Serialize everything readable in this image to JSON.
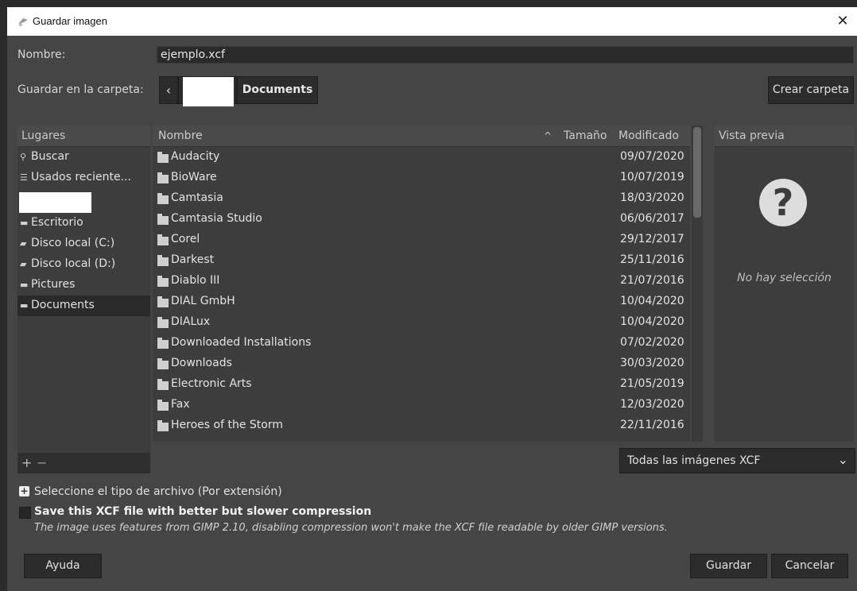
{
  "window": {
    "title": "Guardar imagen",
    "close_glyph": "✕"
  },
  "name": {
    "label": "Nombre:",
    "value": "ejemplo.xcf"
  },
  "folder": {
    "label": "Guardar en la carpeta:",
    "back_glyph": "‹",
    "current": "Documents",
    "create_label": "Crear carpeta"
  },
  "places": {
    "header": "Lugares",
    "items": [
      {
        "label": "Buscar",
        "icon": "search-icon",
        "glyph": "🔍"
      },
      {
        "label": "Usados reciente...",
        "icon": "recent-icon",
        "glyph": "☰"
      },
      {
        "label": "Escritorio",
        "icon": "folder-icon",
        "glyph": "▬"
      },
      {
        "label": "Disco local (C:)",
        "icon": "drive-icon",
        "glyph": "▰"
      },
      {
        "label": "Disco local (D:)",
        "icon": "drive-icon",
        "glyph": "▰"
      },
      {
        "label": "Pictures",
        "icon": "folder-icon",
        "glyph": "▬"
      },
      {
        "label": "Documents",
        "icon": "folder-icon",
        "glyph": "▬"
      }
    ],
    "add_glyph": "+",
    "remove_glyph": "−"
  },
  "files": {
    "headers": {
      "name": "Nombre",
      "sort_glyph": "^",
      "size": "Tamaño",
      "modified": "Modificado"
    },
    "rows": [
      {
        "name": "Audacity",
        "modified": "09/07/2020"
      },
      {
        "name": "BioWare",
        "modified": "10/07/2019"
      },
      {
        "name": "Camtasia",
        "modified": "18/03/2020"
      },
      {
        "name": "Camtasia Studio",
        "modified": "06/06/2017"
      },
      {
        "name": "Corel",
        "modified": "29/12/2017"
      },
      {
        "name": "Darkest",
        "modified": "25/11/2016"
      },
      {
        "name": "Diablo III",
        "modified": "21/07/2016"
      },
      {
        "name": "DIAL GmbH",
        "modified": "10/04/2020"
      },
      {
        "name": "DIALux",
        "modified": "10/04/2020"
      },
      {
        "name": "Downloaded Installations",
        "modified": "07/02/2020"
      },
      {
        "name": "Downloads",
        "modified": "30/03/2020"
      },
      {
        "name": "Electronic Arts",
        "modified": "21/05/2019"
      },
      {
        "name": "Fax",
        "modified": "12/03/2020"
      },
      {
        "name": "Heroes of the Storm",
        "modified": "22/11/2016"
      }
    ]
  },
  "preview": {
    "header": "Vista previa",
    "icon_glyph": "?",
    "empty_text": "No hay selección"
  },
  "filter": {
    "selected": "Todas las imágenes XCF",
    "chevron_glyph": "⌄"
  },
  "options": {
    "expander_glyph": "+",
    "expander_label": "Seleccione el tipo de archivo (Por extensión)",
    "compress_label": "Save this XCF file with better but slower compression",
    "compress_hint": "The image uses features from GIMP 2.10, disabling compression won't make the XCF file readable by older GIMP versions."
  },
  "buttons": {
    "help": "Ayuda",
    "save": "Guardar",
    "cancel": "Cancelar"
  }
}
